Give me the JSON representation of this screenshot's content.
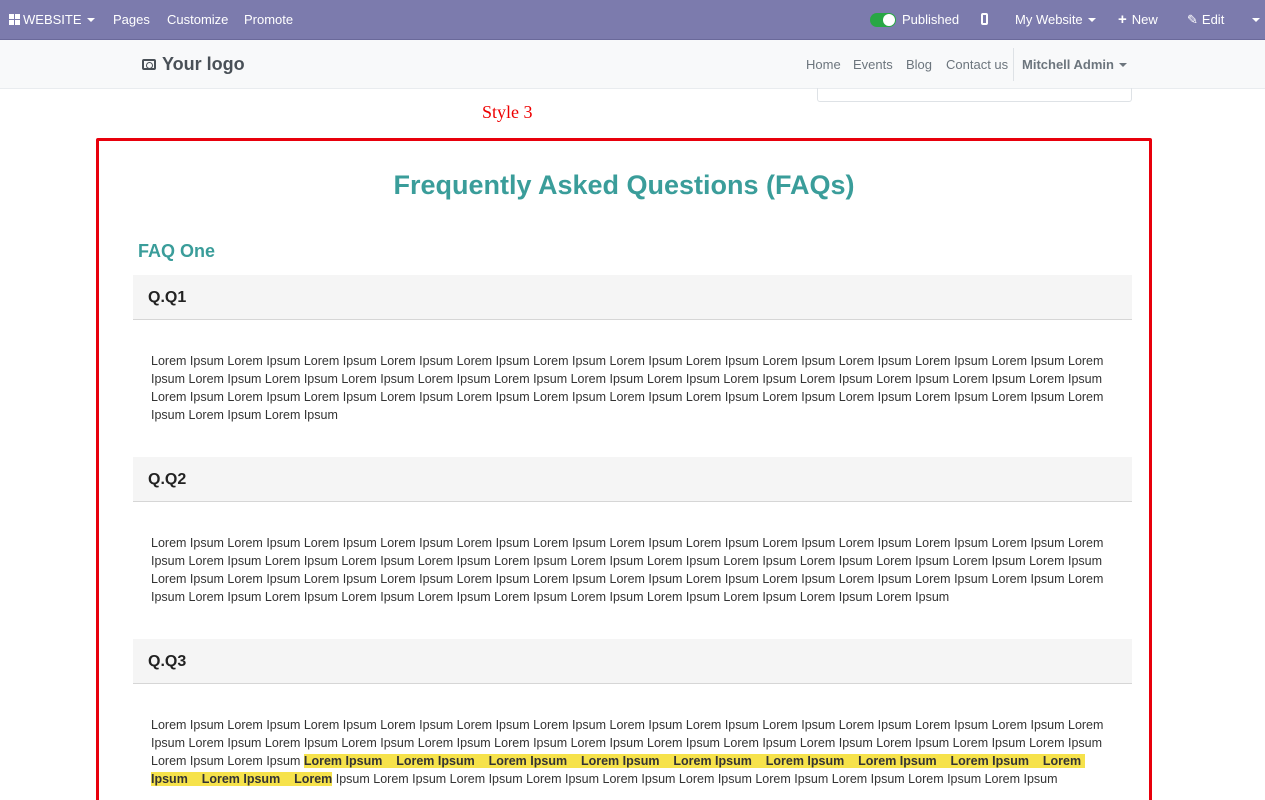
{
  "admin_bar": {
    "website_label": "WEBSITE",
    "pages_label": "Pages",
    "customize_label": "Customize",
    "promote_label": "Promote",
    "published_label": "Published",
    "my_website_label": "My Website",
    "new_label": "New",
    "edit_label": "Edit",
    "bar_color": "#7c7bad"
  },
  "header": {
    "logo_text": "Your logo",
    "nav": [
      "Home",
      "Events",
      "Blog",
      "Contact us"
    ],
    "user_name": "Mitchell Admin"
  },
  "style_label": "Style 3",
  "faq": {
    "title": "Frequently Asked Questions (FAQs)",
    "section_title": "FAQ One",
    "accent_color": "#3a9d9a",
    "border_color": "#e8000c",
    "questions": [
      {
        "title": "Q.Q1",
        "body": "Lorem Ipsum Lorem Ipsum Lorem Ipsum Lorem Ipsum Lorem Ipsum Lorem Ipsum Lorem Ipsum Lorem Ipsum Lorem Ipsum Lorem Ipsum Lorem Ipsum Lorem Ipsum Lorem Ipsum Lorem Ipsum Lorem Ipsum Lorem Ipsum Lorem Ipsum Lorem Ipsum Lorem Ipsum Lorem Ipsum Lorem Ipsum Lorem Ipsum Lorem Ipsum Lorem Ipsum Lorem Ipsum Lorem Ipsum Lorem Ipsum Lorem Ipsum Lorem Ipsum Lorem Ipsum Lorem Ipsum Lorem Ipsum Lorem Ipsum Lorem Ipsum Lorem Ipsum Lorem Ipsum Lorem Ipsum Lorem Ipsum Lorem Ipsum Lorem Ipsum"
      },
      {
        "title": "Q.Q2",
        "body": "Lorem Ipsum Lorem Ipsum Lorem Ipsum Lorem Ipsum Lorem Ipsum Lorem Ipsum Lorem Ipsum Lorem Ipsum Lorem Ipsum Lorem Ipsum Lorem Ipsum Lorem Ipsum Lorem Ipsum Lorem Ipsum Lorem Ipsum Lorem Ipsum Lorem Ipsum Lorem Ipsum Lorem Ipsum Lorem Ipsum Lorem Ipsum Lorem Ipsum Lorem Ipsum Lorem Ipsum Lorem Ipsum Lorem Ipsum Lorem Ipsum Lorem Ipsum Lorem Ipsum Lorem Ipsum Lorem Ipsum Lorem Ipsum Lorem Ipsum Lorem Ipsum Lorem Ipsum Lorem Ipsum Lorem Ipsum Lorem Ipsum Lorem Ipsum Lorem Ipsum Lorem Ipsum Lorem Ipsum Lorem Ipsum Lorem Ipsum Lorem Ipsum Lorem Ipsum Lorem Ipsum Lorem Ipsum"
      },
      {
        "title": "Q.Q3",
        "body_before": "Lorem Ipsum Lorem Ipsum Lorem Ipsum Lorem Ipsum Lorem Ipsum Lorem Ipsum Lorem Ipsum Lorem Ipsum Lorem Ipsum Lorem Ipsum Lorem Ipsum Lorem Ipsum Lorem Ipsum Lorem Ipsum Lorem Ipsum Lorem Ipsum Lorem Ipsum Lorem Ipsum Lorem Ipsum Lorem Ipsum Lorem Ipsum Lorem Ipsum Lorem Ipsum Lorem Ipsum Lorem Ipsum Lorem Ipsum Lorem Ipsum ",
        "body_highlight": "Lorem Ipsum    Lorem Ipsum    Lorem Ipsum    Lorem Ipsum    Lorem Ipsum    Lorem Ipsum    Lorem Ipsum    Lorem Ipsum    Lorem Ipsum    Lorem Ipsum    Lorem",
        "body_after": " Ipsum Lorem Ipsum Lorem Ipsum Lorem Ipsum Lorem Ipsum Lorem Ipsum Lorem Ipsum Lorem Ipsum Lorem Ipsum Lorem Ipsum"
      }
    ]
  }
}
